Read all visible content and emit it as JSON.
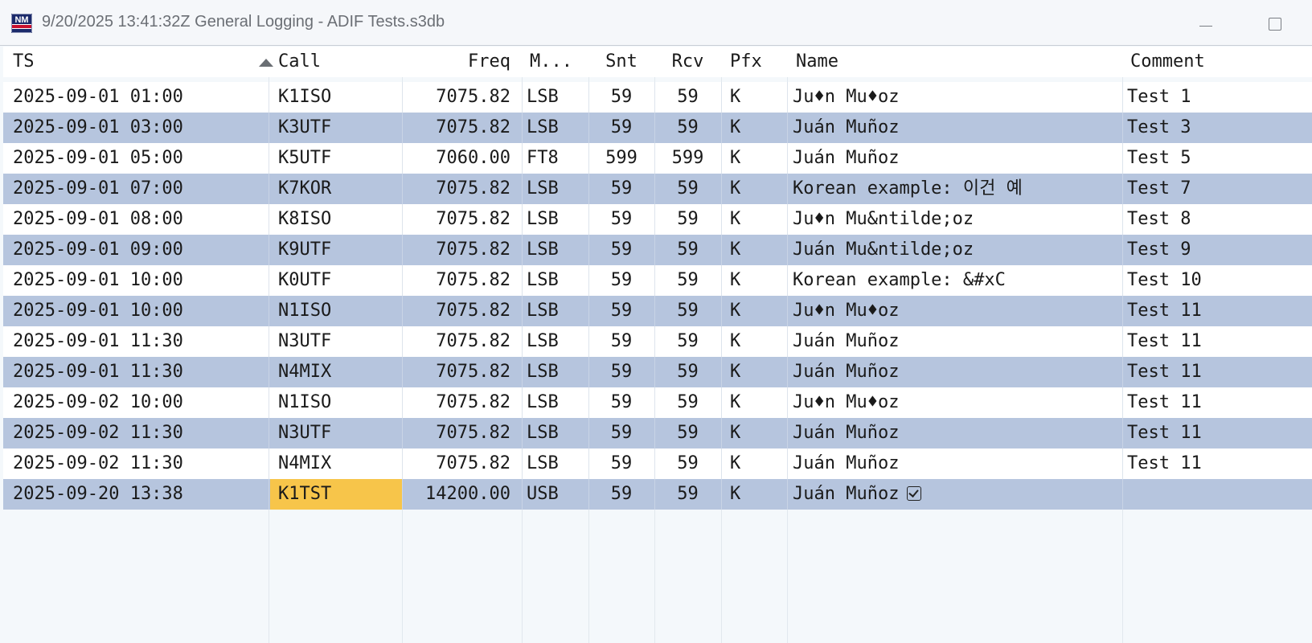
{
  "window": {
    "title": "9/20/2025 13:41:32Z  General Logging - ADIF Tests.s3db",
    "icon": "nm-app-logo"
  },
  "columns": {
    "ts": "TS",
    "call": "Call",
    "freq": "Freq",
    "mode": "M...",
    "snt": "Snt",
    "rcv": "Rcv",
    "pfx": "Pfx",
    "name": "Name",
    "comment": "Comment"
  },
  "sort": {
    "column": "Call",
    "direction": "ascending"
  },
  "rows": [
    {
      "ts": "2025-09-01 01:00",
      "call": "K1ISO",
      "freq": "7075.82",
      "mode": "LSB",
      "snt": "59",
      "rcv": "59",
      "pfx": "K",
      "name": "Ju♦n Mu♦oz",
      "comment": "Test 1"
    },
    {
      "ts": "2025-09-01 03:00",
      "call": "K3UTF",
      "freq": "7075.82",
      "mode": "LSB",
      "snt": "59",
      "rcv": "59",
      "pfx": "K",
      "name": "Juán Muñoz",
      "comment": "Test 3"
    },
    {
      "ts": "2025-09-01 05:00",
      "call": "K5UTF",
      "freq": "7060.00",
      "mode": "FT8",
      "snt": "599",
      "rcv": "599",
      "pfx": "K",
      "name": "Juán Muñoz",
      "comment": "Test 5"
    },
    {
      "ts": "2025-09-01 07:00",
      "call": "K7KOR",
      "freq": "7075.82",
      "mode": "LSB",
      "snt": "59",
      "rcv": "59",
      "pfx": "K",
      "name": "Korean example: 이건 예",
      "comment": "Test 7"
    },
    {
      "ts": "2025-09-01 08:00",
      "call": "K8ISO",
      "freq": "7075.82",
      "mode": "LSB",
      "snt": "59",
      "rcv": "59",
      "pfx": "K",
      "name": "Ju♦n Mu&ntilde;oz",
      "comment": "Test 8"
    },
    {
      "ts": "2025-09-01 09:00",
      "call": "K9UTF",
      "freq": "7075.82",
      "mode": "LSB",
      "snt": "59",
      "rcv": "59",
      "pfx": "K",
      "name": "Juán Mu&ntilde;oz",
      "comment": "Test 9"
    },
    {
      "ts": "2025-09-01 10:00",
      "call": "K0UTF",
      "freq": "7075.82",
      "mode": "LSB",
      "snt": "59",
      "rcv": "59",
      "pfx": "K",
      "name": "Korean example: &#xC",
      "comment": "Test 10"
    },
    {
      "ts": "2025-09-01 10:00",
      "call": "N1ISO",
      "freq": "7075.82",
      "mode": "LSB",
      "snt": "59",
      "rcv": "59",
      "pfx": "K",
      "name": "Ju♦n Mu♦oz",
      "comment": "Test 11"
    },
    {
      "ts": "2025-09-01 11:30",
      "call": "N3UTF",
      "freq": "7075.82",
      "mode": "LSB",
      "snt": "59",
      "rcv": "59",
      "pfx": "K",
      "name": "Juán Muñoz",
      "comment": "Test 11"
    },
    {
      "ts": "2025-09-01 11:30",
      "call": "N4MIX",
      "freq": "7075.82",
      "mode": "LSB",
      "snt": "59",
      "rcv": "59",
      "pfx": "K",
      "name": "Juán Muñoz",
      "comment": "Test 11"
    },
    {
      "ts": "2025-09-02 10:00",
      "call": "N1ISO",
      "freq": "7075.82",
      "mode": "LSB",
      "snt": "59",
      "rcv": "59",
      "pfx": "K",
      "name": "Ju♦n Mu♦oz",
      "comment": "Test 11"
    },
    {
      "ts": "2025-09-02 11:30",
      "call": "N3UTF",
      "freq": "7075.82",
      "mode": "LSB",
      "snt": "59",
      "rcv": "59",
      "pfx": "K",
      "name": "Juán Muñoz",
      "comment": "Test 11"
    },
    {
      "ts": "2025-09-02 11:30",
      "call": "N4MIX",
      "freq": "7075.82",
      "mode": "LSB",
      "snt": "59",
      "rcv": "59",
      "pfx": "K",
      "name": "Juán Muñoz",
      "comment": "Test 11"
    },
    {
      "ts": "2025-09-20 13:38",
      "call": "K1TST",
      "freq": "14200.00",
      "mode": "USB",
      "snt": "59",
      "rcv": "59",
      "pfx": "K",
      "name": "Juán Muñoz",
      "comment": "",
      "name_icon": "checkbox-checked-icon"
    }
  ],
  "colors": {
    "alt_row": "#b6c5de",
    "selected_cell": "#f7c54a",
    "title_text": "#6b6f75"
  }
}
